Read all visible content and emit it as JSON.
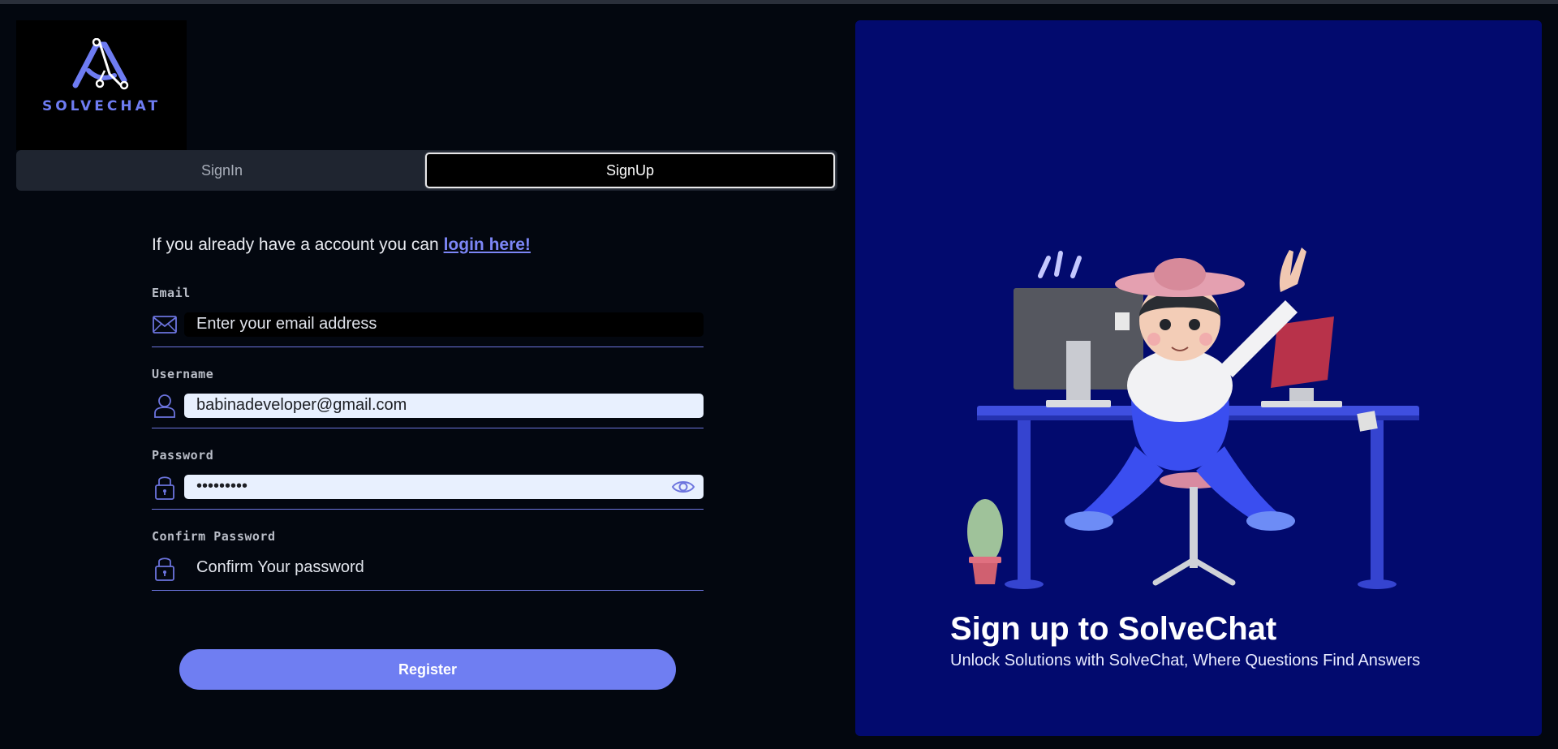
{
  "brand": {
    "name": "SOLVECHAT",
    "accent": "#6f7ef2",
    "panel_bg": "#020a6e"
  },
  "tabs": [
    {
      "label": "SignIn",
      "active": false
    },
    {
      "label": "SignUp",
      "active": true
    }
  ],
  "form": {
    "intro_text": "If you already have a account you can ",
    "intro_link": "login here!",
    "email": {
      "label": "Email",
      "placeholder": "Enter your email address",
      "value": "",
      "icon": "mail-icon"
    },
    "username": {
      "label": "Username",
      "value": "babinadeveloper@gmail.com",
      "icon": "user-icon"
    },
    "password": {
      "label": "Password",
      "value": "•••••••••",
      "icon": "lock-icon",
      "toggle_icon": "eye-icon"
    },
    "confirm_password": {
      "label": "Confirm Password",
      "placeholder": "Confirm Your password",
      "value": "",
      "icon": "lock-icon"
    },
    "submit_label": "Register"
  },
  "hero": {
    "title": "Sign up to SolveChat",
    "subtitle": "Unlock Solutions with SolveChat, Where Questions Find Answers",
    "illustration": "person-at-desk-illustration"
  }
}
